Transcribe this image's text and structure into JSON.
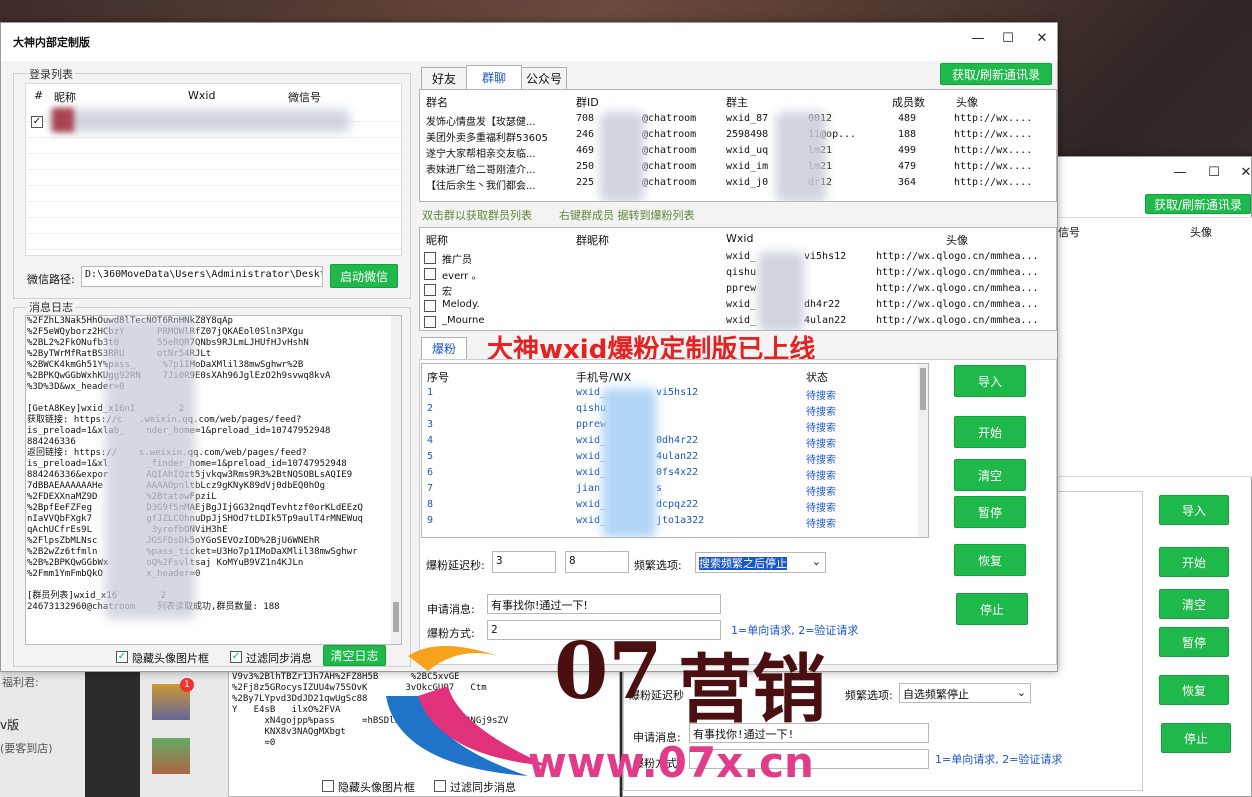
{
  "main_window": {
    "title": "大神内部定制版",
    "controls": {
      "min": "—",
      "max": "☐",
      "close": "✕"
    },
    "login_group": {
      "title": "登录列表",
      "headers": [
        "#",
        "昵称",
        "Wxid",
        "微信号"
      ]
    },
    "wechat_path_label": "微信路径:",
    "wechat_path_value": "D:\\360MoveData\\Users\\Administrator\\Deskt",
    "start_wechat_button": "启动微信",
    "log_group_title": "消息日志",
    "log_lines": [
      "%2FZhL3Nak5HhOuwd8lTecNOT6RnHNkZ8Y8qAp",
      "%2F5eWQyborz2HCbzY      PRMOWlRfZ07jQKAEol0Sln3PXgu",
      "%2BL2%2FkONufb3t0       55eRQR7QNbs9RJLmLJHUfHJvHshN",
      "%2ByTWrMfRatBS3RRU      otNr54RJLt",
      "%2BWCK4kmGh51Y%pass_     %7p1IMoDaXMlil38mwSghwr%2B",
      "%2BPKQwGGbWxhKUgg92RN    7Ji0R9E0sXAh96JglEzO2h9svwq8kvA",
      "%3D%3D&wx_header=0",
      "",
      "[GetA8Key]wxid_x16n1        2",
      "获取链接: https://c   .weixin.qq.com/web/pages/feed?",
      "is_preload=1&xlab_    nder_home=1&preload_id=10747952948",
      "884246336",
      "返回链接: https://    s.weixin.qq.com/web/pages/feed?",
      "is_preload=1&xl       _finder_home=1&preload_id=10747952948",
      "884246336&expor       AQIAhIQzt5jvkqw3Rms9R3%2BtNQSOBLsAQIE9",
      "7dBBAEAAAAAAHe        AAAAOpnltbLcz9gKNyK89dVj0dbEQ0hOg",
      "%2FDEXXnaMZ9D         %2BtatowFpziL",
      "%2BpfEeFZFeg          D3G9fSnMAEjBgJIjGG32nqdTevhtzf0orKLdEEzQ",
      "nIaVVQbFXgk7          gfJZLCOhnuDpJjSHOd7tLDIk5Tp9aulT4rMNEWuq",
      "qAchUCfrEs9L           3yrofbONViH3hE",
      "%2FlpsZbMLNsc         JGSFDsDk5oYGoSEVOzIOD%2BjU6WNEhR",
      "%2B2wZz6tfmln         %pass_ticket=U3Ho7p1IMoDaXMlil38mwSghwr",
      "%2B%2BPKQwGGbWx       oQ%2Fsvltsaj KoMYuB9VZ1n4KJLn",
      "%2Fmm1YmFmbQkO        x_header=0",
      "",
      "[群员列表]wxid_x16        2",
      "24673132960@chatroom    列表读取成功,群员数量: 188"
    ],
    "hide_avatar_checkbox": "隐藏头像图片框",
    "filter_sync_checkbox": "过滤同步消息",
    "clear_log_button": "清空日志",
    "tabs": [
      "好友",
      "群聊",
      "公众号"
    ],
    "refresh_contacts_button": "获取/刷新通讯录",
    "group_table": {
      "headers": [
        "群名",
        "群ID",
        "群主",
        "成员数",
        "头像"
      ],
      "rows": [
        [
          "发饰心情盘发【玫瑟健...",
          "708",
          "@chatroom",
          "wxid_87",
          "0012",
          "489",
          "http://wx...."
        ],
        [
          "美团外卖多重福利群53605",
          "246",
          "@chatroom",
          "2598498",
          "11@op...",
          "188",
          "http://wx...."
        ],
        [
          "遂宁大家帮相亲交友临...",
          "469",
          "@chatroom",
          "wxid_uq",
          "lm21",
          "499",
          "http://wx...."
        ],
        [
          "表妹进厂给二哥刚渣介...",
          "250",
          "@chatroom",
          "wxid_im",
          "lm21",
          "479",
          "http://wx...."
        ],
        [
          "【往后余生丶我们都会...",
          "225",
          "@chatroom",
          "wxid_j0",
          "dr12",
          "364",
          "http://wx...."
        ]
      ]
    },
    "hint_left": "双击群以获取群员列表",
    "hint_right": "右键群成员     据转到爆粉列表",
    "member_table": {
      "headers": [
        "昵称",
        "群昵称",
        "Wxid",
        "头像"
      ],
      "rows": [
        [
          "推广员",
          "wxid_",
          "vi5hs12",
          "http://wx.qlogo.cn/mmhea..."
        ],
        [
          "everr 。",
          "qishu",
          "",
          "http://wx.qlogo.cn/mmhea..."
        ],
        [
          "宏",
          "pprew",
          "",
          "http://wx.qlogo.cn/mmhea..."
        ],
        [
          "Melody.",
          "wxid_",
          "dh4r22",
          "http://wx.qlogo.cn/mmhea..."
        ],
        [
          "_Mourne",
          "wxid_",
          "4ulan22",
          "http://wx.qlogo.cn/mmhea..."
        ]
      ]
    },
    "boost_tab": "爆粉",
    "banner_text": "大神wxid爆粉定制版已上线",
    "boost_table": {
      "headers": [
        "序号",
        "手机号/WX",
        "状态"
      ],
      "rows": [
        [
          "1",
          "wxid_",
          "vi5hs12",
          "待搜索"
        ],
        [
          "2",
          "qishu",
          "",
          "待搜索"
        ],
        [
          "3",
          "pprew",
          "",
          "待搜索"
        ],
        [
          "4",
          "wxid_",
          "0dh4r22",
          "待搜索"
        ],
        [
          "5",
          "wxid_",
          "4ulan22",
          "待搜索"
        ],
        [
          "6",
          "wxid_",
          "0fs4x22",
          "待搜索"
        ],
        [
          "7",
          "jian",
          "s",
          "待搜索"
        ],
        [
          "8",
          "wxid_",
          "dcpqz22",
          "待搜索"
        ],
        [
          "9",
          "wxid_",
          "jto1a322",
          "待搜索"
        ]
      ]
    },
    "side_buttons": [
      "导入",
      "开始",
      "清空",
      "暂停",
      "恢复",
      "停止"
    ],
    "delay_label": "爆粉延迟秒:",
    "delay_min": "3",
    "delay_max": "8",
    "freq_label": "频繁选项:",
    "freq_value": "搜索频繁之后停止",
    "apply_msg_label": "申请消息:",
    "apply_msg_value": "有事找你!通过一下!",
    "mode_label": "爆粉方式:",
    "mode_value": "2",
    "mode_hint": "1=单向请求, 2=验证请求"
  },
  "second_window": {
    "controls": {
      "min": "—",
      "max": "☐",
      "close": "✕"
    },
    "refresh_button": "获取/刷新通讯录",
    "headers": [
      "信号",
      "头像"
    ],
    "side_buttons": [
      "导入",
      "开始",
      "清空",
      "暂停",
      "恢复",
      "停止"
    ],
    "delay_label": "爆粉延迟秒",
    "freq_label": "频繁选项:",
    "freq_value": "自选频繁停止",
    "apply_msg_label": "申请消息:",
    "apply_msg_value": "有事找你!通过一下!",
    "mode_label": "爆粉方式:",
    "mode_hint": "1=单向请求, 2=验证请求",
    "hide_avatar_checkbox": "隐藏头像图片框",
    "filter_sync_checkbox": "过滤同步消息",
    "log_lines": [
      "V9v3%2BlhTBZr1Jh7AH%2FZ8H5B      %2BC5xvGE",
      "%2Fj8z5GRocysIZUU4w75SOvK       3vOkcGUO7   Ctm",
      "%2By7LYpvd3DdJD21qwUgSc88",
      "Y   E4sB   ilxO%2FVA",
      "      xN4gojpp%pass     =hBSDlzwt4Iilcbv1tt3NGj9sZV",
      "      KNX8v3NAQgMXbgt",
      "      =0"
    ]
  },
  "left_panel": {
    "items": [
      "福利君:",
      "v版",
      "(要客到店)"
    ]
  },
  "watermark": {
    "number": "07",
    "brand": "营销",
    "url": "www.07x.cn"
  }
}
